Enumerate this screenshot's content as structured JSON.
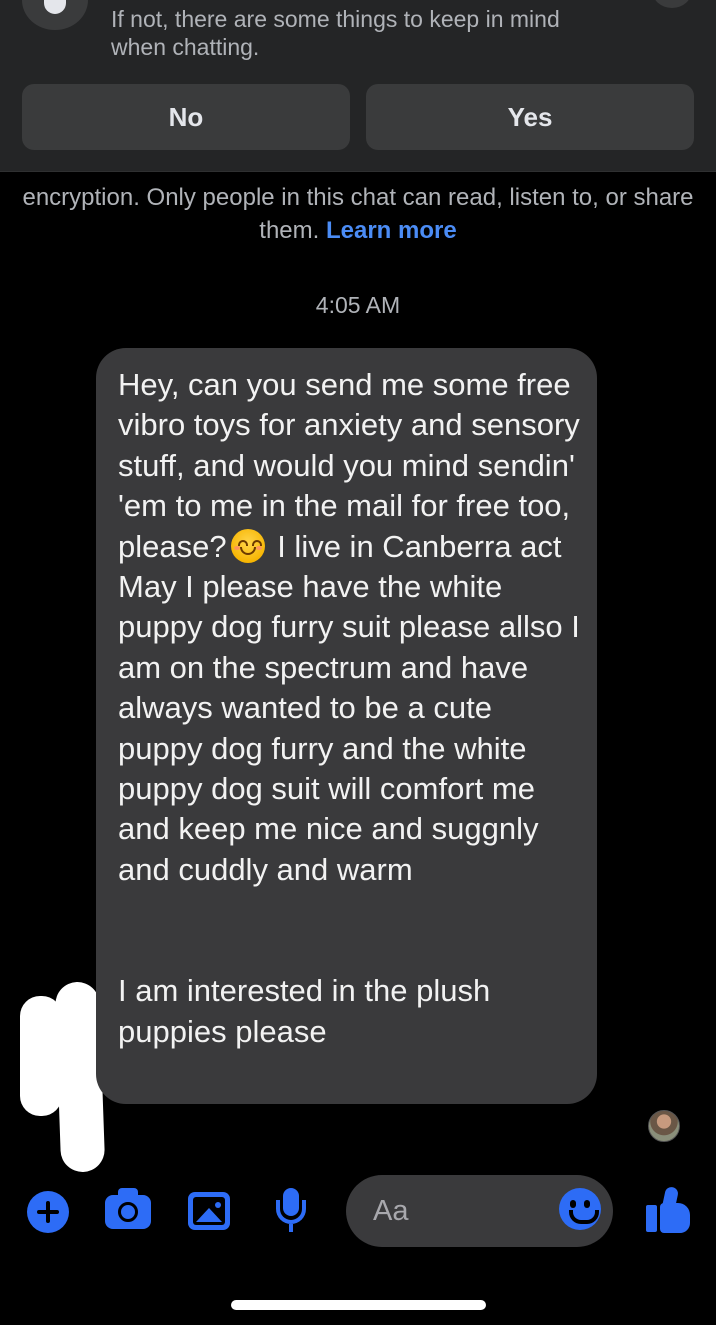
{
  "banner": {
    "text": "If not, there are some things to keep in mind\nwhen chatting.",
    "no_label": "No",
    "yes_label": "Yes"
  },
  "encryption_notice": {
    "text": "encryption. Only people in this chat can read, listen to, or share them. ",
    "link": "Learn more"
  },
  "timestamp": "4:05 AM",
  "message": {
    "part1": "Hey, can you send me some free vibro toys for anxiety and sensory stuff, and would you mind sendin' 'em to me in the mail for free too, please?",
    "emoji": "smiling-face-emoji",
    "part2": " I live in Canberra act\nMay I please have the white puppy dog furry suit please allso I am on the spectrum and have always wanted to be a cute puppy dog furry and the white puppy dog suit will comfort me and keep me nice and suggnly and cuddly and warm\n\n\nI am interested in the plush puppies please"
  },
  "composer": {
    "placeholder": "Aa",
    "icons": [
      "plus-icon",
      "camera-icon",
      "gallery-icon",
      "microphone-icon",
      "emoji-icon",
      "thumbs-up-icon"
    ],
    "accent_color": "#2d6cf6"
  }
}
